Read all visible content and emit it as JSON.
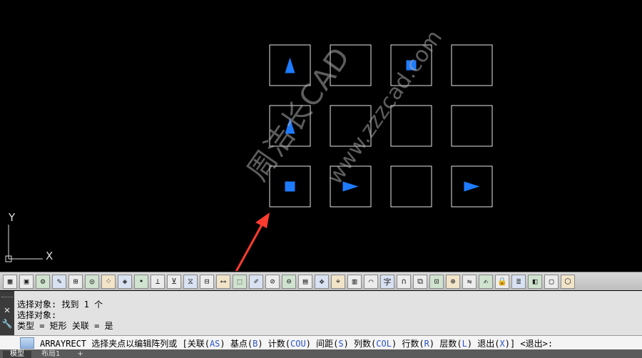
{
  "canvas": {
    "background": "#000000",
    "grid_stroke": "#e6e6e6",
    "shape_color": "#1e7bff",
    "cells": [
      [
        "triangle-up",
        "empty",
        "square",
        null
      ],
      [
        "triangle-up",
        "empty",
        "empty",
        "empty"
      ],
      [
        "square",
        "triangle-right",
        "empty",
        "triangle-right"
      ]
    ],
    "ucs": {
      "y_label": "Y",
      "x_label": "X"
    },
    "watermark": "周洁长CAD",
    "watermark_url": "www.zzzcad.com",
    "arrow_color": "#ff3b30"
  },
  "toolbar": {
    "icons": [
      "layer-icon",
      "save-icon",
      "properties-icon",
      "match-icon",
      "ungroup-icon",
      "circle-icon",
      "array-icon",
      "grips-icon",
      "point-icon",
      "dim-icon",
      "dim2-icon",
      "mirror-icon",
      "block-icon",
      "measure-icon",
      "stretch-icon",
      "hatch-icon",
      "pencil-icon",
      "bisect-icon",
      "lines-icon",
      "move-icon",
      "trim-icon",
      "table-icon",
      "arc-icon",
      "text-icon",
      "clip-icon",
      "copy-icon",
      "zoom-icon",
      "ref-icon",
      "flip-icon",
      "edit-icon",
      "lock-icon",
      "layer2-icon",
      "view-icon",
      "box-icon",
      "cube-icon"
    ],
    "labels": [
      "▦",
      "▣",
      "⚙",
      "✎",
      "⊞",
      "◎",
      "⁘",
      "◈",
      "•",
      "⊥",
      "⊻",
      "⧖",
      "⊟",
      "⟷",
      "⬚",
      "✐",
      "⊘",
      "⊖",
      "▤",
      "✥",
      "⌖",
      "▥",
      "⌒",
      "字",
      "∩",
      "⧉",
      "⊡",
      "⊕",
      "⇋",
      "✍",
      "🔒",
      "≣",
      "◧",
      "▢",
      "⬡"
    ]
  },
  "command": {
    "close_glyph": "✕",
    "settings_glyph": "🔧",
    "lines": [
      "选择对象: 找到 1 个",
      "选择对象:",
      "类型 = 矩形  关联 = 是"
    ],
    "prompt_cmd": "ARRAYRECT",
    "prompt_text": " 选择夹点以编辑阵列或 [关联(",
    "opt1": "AS",
    "t1": ") 基点(",
    "opt2": "B",
    "t2": ") 计数(",
    "opt3": "COU",
    "t3": ") 间距(",
    "opt4": "S",
    "t4": ") 列数(",
    "opt5": "COL",
    "t5": ") 行数(",
    "opt6": "R",
    "t6": ") 层数(",
    "opt7": "L",
    "t7": ") 退出(",
    "opt8": "X",
    "t8": ")] <退出>:"
  },
  "tabs": [
    "模型",
    "布局1",
    "+"
  ]
}
